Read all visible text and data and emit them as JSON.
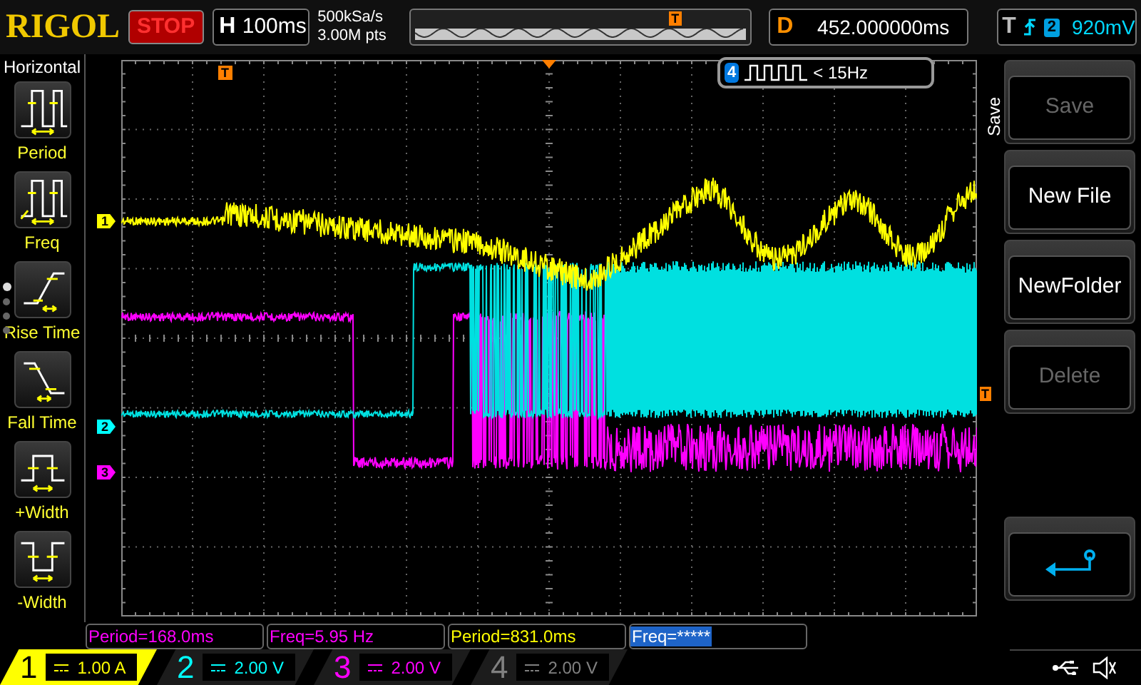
{
  "top_bar": {
    "logo": "RIGOL",
    "run_state": "STOP",
    "timebase_label": "H",
    "timebase": "100ms",
    "sample_rate": "500kSa/s",
    "memory_depth": "3.00M pts",
    "zoom_trigger_marker": "T",
    "delay_label": "D",
    "delay": "452.000000ms",
    "trigger_label": "T",
    "trigger_source": "2",
    "trigger_level": "920mV"
  },
  "left_menu": {
    "title": "Horizontal",
    "items": [
      {
        "kind": "period",
        "label": "Period"
      },
      {
        "kind": "freq",
        "label": "Freq"
      },
      {
        "kind": "rise",
        "label": "Rise Time"
      },
      {
        "kind": "fall",
        "label": "Fall Time"
      },
      {
        "kind": "pwidth",
        "label": "+Width"
      },
      {
        "kind": "nwidth",
        "label": "-Width"
      }
    ],
    "page_dots": [
      {
        "selected": true
      },
      {
        "selected": false
      },
      {
        "selected": false
      },
      {
        "selected": false
      }
    ]
  },
  "scope": {
    "trigger_position_marker": "T",
    "trigger_level_marker": "T",
    "channel_markers": [
      {
        "label": "1",
        "color": "#ffff00"
      },
      {
        "label": "2",
        "color": "#00ffff"
      },
      {
        "label": "3",
        "color": "#ff00ff"
      }
    ],
    "frequency_counter": {
      "channel": "4",
      "reading": "< 15Hz"
    }
  },
  "right_menu": {
    "title": "Save",
    "buttons": [
      {
        "kind": "text",
        "label": "Save",
        "disabled": true
      },
      {
        "kind": "text",
        "label": "New File",
        "disabled": false
      },
      {
        "kind": "text",
        "label": "NewFolder",
        "disabled": false
      },
      {
        "kind": "text",
        "label": "Delete",
        "disabled": true
      },
      {
        "kind": "back"
      }
    ]
  },
  "measurements": [
    {
      "text": "Period=168.0ms",
      "color": "#ff00ff",
      "selected": false
    },
    {
      "text": "Freq=5.95 Hz",
      "color": "#ff00ff",
      "selected": false
    },
    {
      "text": "Period=831.0ms",
      "color": "#ffff00",
      "selected": false
    },
    {
      "text": "Freq=*****",
      "color": "#1e64c8",
      "selected": true
    }
  ],
  "channels": [
    {
      "number": "1",
      "scale": "1.00 A",
      "color": "#ffff00",
      "selected": true
    },
    {
      "number": "2",
      "scale": "2.00 V",
      "color": "#00ffff",
      "selected": false
    },
    {
      "number": "3",
      "scale": "2.00 V",
      "color": "#ff00ff",
      "selected": false
    },
    {
      "number": "4",
      "scale": "2.00 V",
      "color": "#808080",
      "selected": false
    }
  ]
}
